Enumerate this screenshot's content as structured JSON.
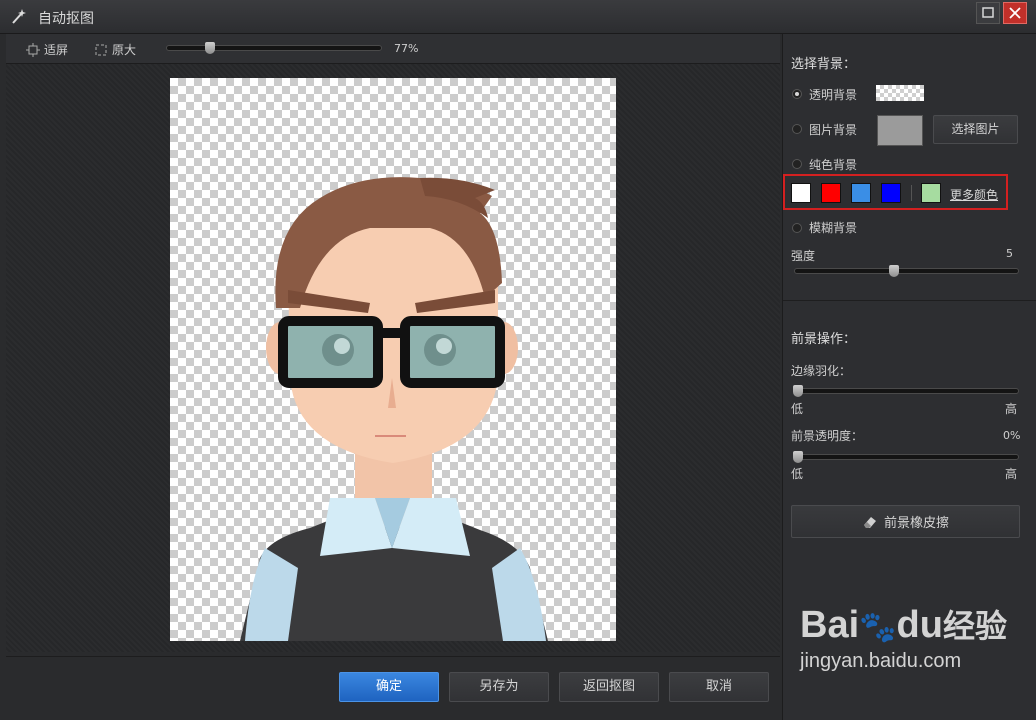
{
  "window": {
    "title": "自动抠图"
  },
  "toolbar": {
    "fit_label": "适屏",
    "original_label": "原大",
    "zoom": "77%"
  },
  "background": {
    "section_title": "选择背景：",
    "transparent_label": "透明背景",
    "image_label": "图片背景",
    "choose_image_button": "选择图片",
    "solid_label": "纯色背景",
    "swatches": [
      "#ffffff",
      "#ff0000",
      "#3a8ee6",
      "#0000ff",
      "#a6dca0"
    ],
    "more_colors_link": "更多颜色",
    "blur_label": "模糊背景",
    "strength_label": "强度",
    "strength_value": "5"
  },
  "foreground": {
    "section_title": "前景操作：",
    "feather_label": "边缘羽化：",
    "feather_low": "低",
    "feather_high": "高",
    "opacity_label": "前景透明度：",
    "opacity_value": "0%",
    "opacity_low": "低",
    "opacity_high": "高",
    "eraser_button": "前景橡皮擦"
  },
  "footer": {
    "confirm_button": "确定",
    "save_as_button": "另存为",
    "back_button": "返回抠图",
    "cancel_button": "取消"
  },
  "watermark": {
    "brand": "Bai",
    "brand2": "du",
    "brand_cn": "经验",
    "url": "jingyan.baidu.com"
  },
  "accent_color": "#2a74d6",
  "highlight_color": "#d42020"
}
